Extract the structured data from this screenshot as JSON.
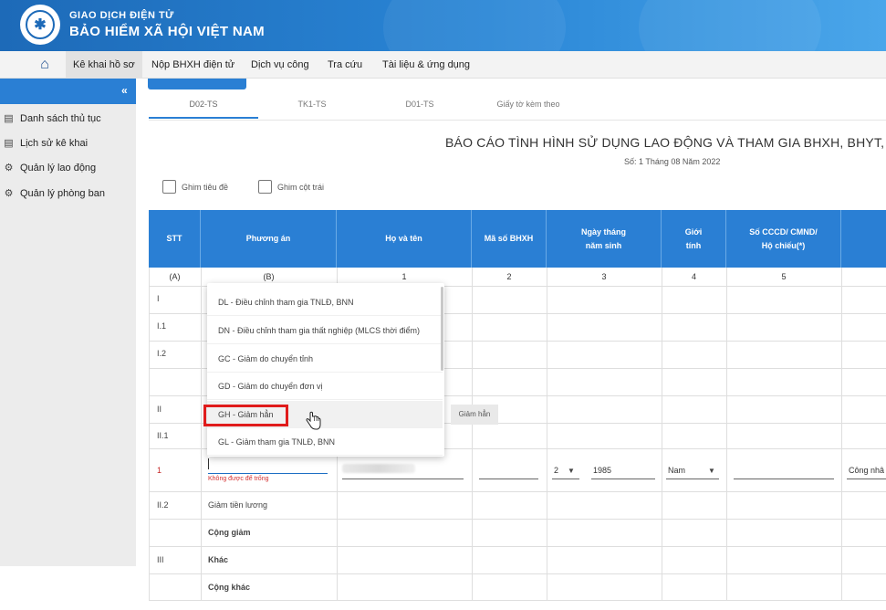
{
  "header": {
    "brand_line1": "GIAO DỊCH ĐIỆN TỬ",
    "brand_line2": "BẢO HIỂM XÃ HỘI VIỆT NAM"
  },
  "menu": {
    "items": [
      "Kê khai hồ sơ",
      "Nộp BHXH điện tử",
      "Dịch vụ công",
      "Tra cứu",
      "Tài liệu & ứng dụng"
    ],
    "active": "Kê khai hồ sơ"
  },
  "sidebar": {
    "items": [
      "Danh sách thủ tục",
      "Lịch sử kê khai",
      "Quản lý lao động",
      "Quản lý phòng ban"
    ]
  },
  "tabs": [
    "D02-TS",
    "TK1-TS",
    "D01-TS",
    "Giấy tờ kèm theo"
  ],
  "report": {
    "title": "BÁO CÁO TÌNH HÌNH SỬ DỤNG LAO ĐỘNG VÀ THAM GIA BHXH, BHYT, BHT",
    "subtitle": "Số: 1 Tháng 08 Năm 2022"
  },
  "options": {
    "pin_title": "Ghim tiêu đề",
    "pin_left_col": "Ghim cột trái"
  },
  "table": {
    "headers": {
      "stt": "STT",
      "phuong_an": "Phương án",
      "ho_ten": "Họ và tên",
      "ma_so": "Mã số BHXH",
      "ngay_sinh": "Ngày tháng\nnăm sinh",
      "gioi_tinh": "Giới\ntính",
      "cccd": "Số CCCD/ CMND/\nHộ chiếu(*)"
    },
    "col_numbers": [
      "(A)",
      "(B)",
      "1",
      "2",
      "3",
      "4",
      "5"
    ],
    "rows": {
      "r1": "I",
      "r2": "I.1",
      "r3": "I.2",
      "r4": "II",
      "r5": "II.1",
      "r6": "1",
      "r7": "II.2",
      "r7_text": "Giảm tiền lương",
      "r8_text": "Cộng giảm",
      "r9": "III",
      "r9_text": "Khác",
      "r10_text": "Cộng khác"
    },
    "row1_inputs": {
      "day": "2",
      "year": "1985",
      "gender": "Nam",
      "extra": "Công nhâ",
      "error": "Không được để trống"
    }
  },
  "dropdown": {
    "items": [
      "DL - Điều chỉnh tham gia TNLĐ, BNN",
      "DN - Điều chỉnh tham gia thất nghiệp (MLCS thời điểm)",
      "GC - Giảm do chuyển tỉnh",
      "GD - Giảm do chuyển đơn vị",
      "GH - Giảm hẳn",
      "GL - Giảm tham gia TNLĐ, BNN"
    ],
    "tooltip": "Giảm hẳn"
  }
}
